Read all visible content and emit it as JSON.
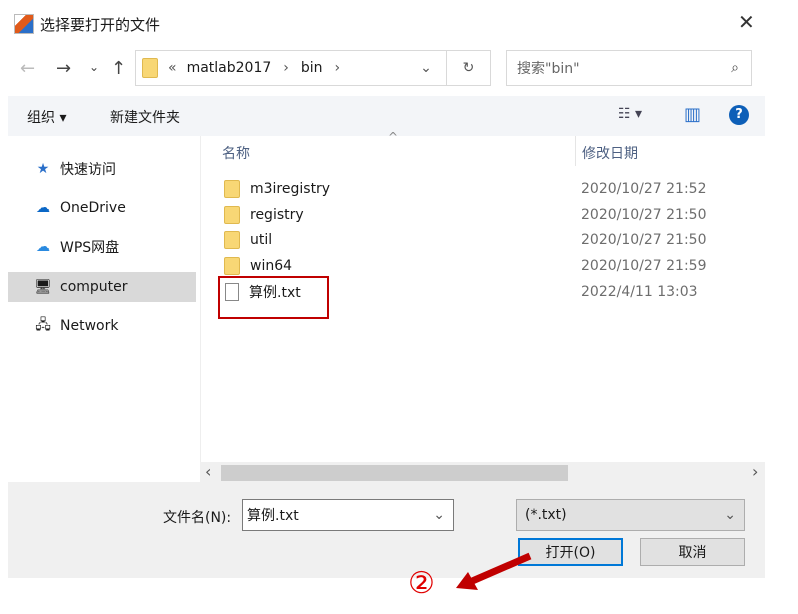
{
  "window": {
    "title": "选择要打开的文件",
    "close": "✕"
  },
  "nav": {
    "back": "←",
    "forward": "→",
    "recent": "⌄",
    "up": "↑"
  },
  "address": {
    "overflow": "«",
    "segments": [
      "matlab2017",
      "bin"
    ],
    "sep": "›",
    "dropdown": "⌄",
    "refresh": "↻"
  },
  "search": {
    "placeholder": "搜索\"bin\"",
    "icon": "⌕"
  },
  "toolbar": {
    "organize": "组织 ▾",
    "new_folder": "新建文件夹",
    "view": "☷ ▾",
    "pane": "▥",
    "help": "?"
  },
  "sidebar": {
    "items": [
      {
        "label": "快速访问",
        "icon": "★"
      },
      {
        "label": "OneDrive",
        "icon": "☁"
      },
      {
        "label": "WPS网盘",
        "icon": "☁"
      },
      {
        "label": "computer",
        "icon": "🖥"
      },
      {
        "label": "Network",
        "icon": "🖧"
      }
    ],
    "selected": "computer"
  },
  "columns": {
    "name": "名称",
    "date": "修改日期",
    "sort": "^"
  },
  "files": [
    {
      "name": "m3iregistry",
      "date": "2020/10/27 21:52",
      "type": "folder"
    },
    {
      "name": "registry",
      "date": "2020/10/27 21:50",
      "type": "folder"
    },
    {
      "name": "util",
      "date": "2020/10/27 21:50",
      "type": "folder"
    },
    {
      "name": "win64",
      "date": "2020/10/27 21:59",
      "type": "folder"
    },
    {
      "name": "算例.txt",
      "date": "2022/4/11 13:03",
      "type": "text"
    }
  ],
  "scroll": {
    "left": "‹",
    "right": "›"
  },
  "bottom": {
    "filename_label": "文件名(N):",
    "filename_value": "算例.txt",
    "filter": "(*.txt)",
    "open": "打开(O)",
    "cancel": "取消",
    "chevron": "⌄"
  },
  "annotation": {
    "step": "②",
    "color": "#c00000"
  }
}
